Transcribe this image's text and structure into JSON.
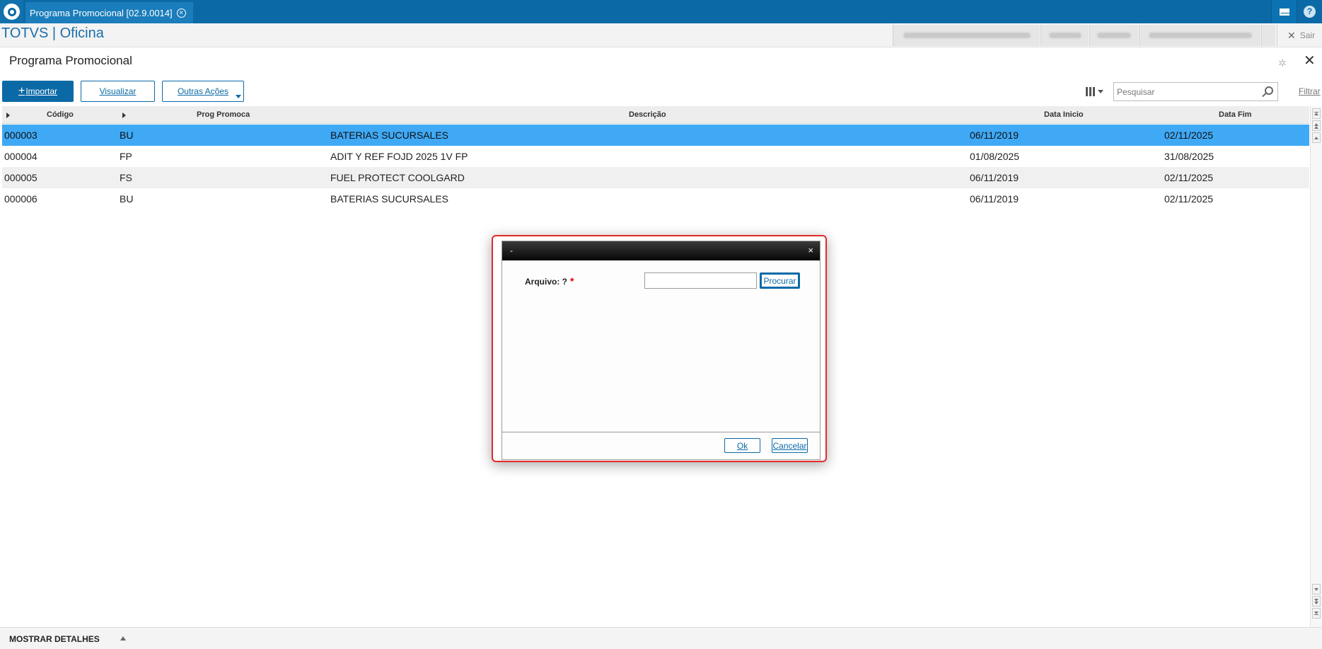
{
  "topbar": {
    "tab_label": "Programa Promocional [02.9.0014]",
    "tab_close": "×",
    "help_icon_text": "?"
  },
  "header": {
    "brand": "TOTVS | Oficina",
    "exit_label": "Sair",
    "exit_icon": "✕"
  },
  "page": {
    "title": "Programa Promocional",
    "close": "✕",
    "gear": "✲"
  },
  "toolbar": {
    "import_label": "Importar",
    "import_icon": "+",
    "view_label": "Visualizar",
    "more_label": "Outras Ações",
    "search_placeholder": "Pesquisar",
    "filter_label": "Filtrar"
  },
  "grid": {
    "columns": {
      "codigo": "Código",
      "prog": "Prog Promoca",
      "descricao": "Descrição",
      "data_inicio": "Data Inicio",
      "data_fim": "Data Fim"
    },
    "rows": [
      {
        "codigo": "000003",
        "prog": "BU",
        "descricao": "BATERIAS SUCURSALES",
        "data_inicio": "06/11/2019",
        "data_fim": "02/11/2025"
      },
      {
        "codigo": "000004",
        "prog": "FP",
        "descricao": "ADIT Y REF FOJD 2025 1V FP",
        "data_inicio": "01/08/2025",
        "data_fim": "31/08/2025"
      },
      {
        "codigo": "000005",
        "prog": "FS",
        "descricao": "FUEL PROTECT COOLGARD",
        "data_inicio": "06/11/2019",
        "data_fim": "02/11/2025"
      },
      {
        "codigo": "000006",
        "prog": "BU",
        "descricao": "BATERIAS SUCURSALES",
        "data_inicio": "06/11/2019",
        "data_fim": "02/11/2025"
      }
    ]
  },
  "footer": {
    "details_label": "MOSTRAR DETALHES"
  },
  "dialog": {
    "title": "-",
    "close": "×",
    "field_label": "Arquivo: ?",
    "required_mark": "*",
    "field_value": "",
    "browse_label": "Procurar",
    "ok_label": "Ok",
    "cancel_label": "Cancelar"
  },
  "colors": {
    "brand_blue": "#0b6aa6",
    "selected_row": "#3fa9f5",
    "dialog_highlight": "#e22a2a"
  }
}
